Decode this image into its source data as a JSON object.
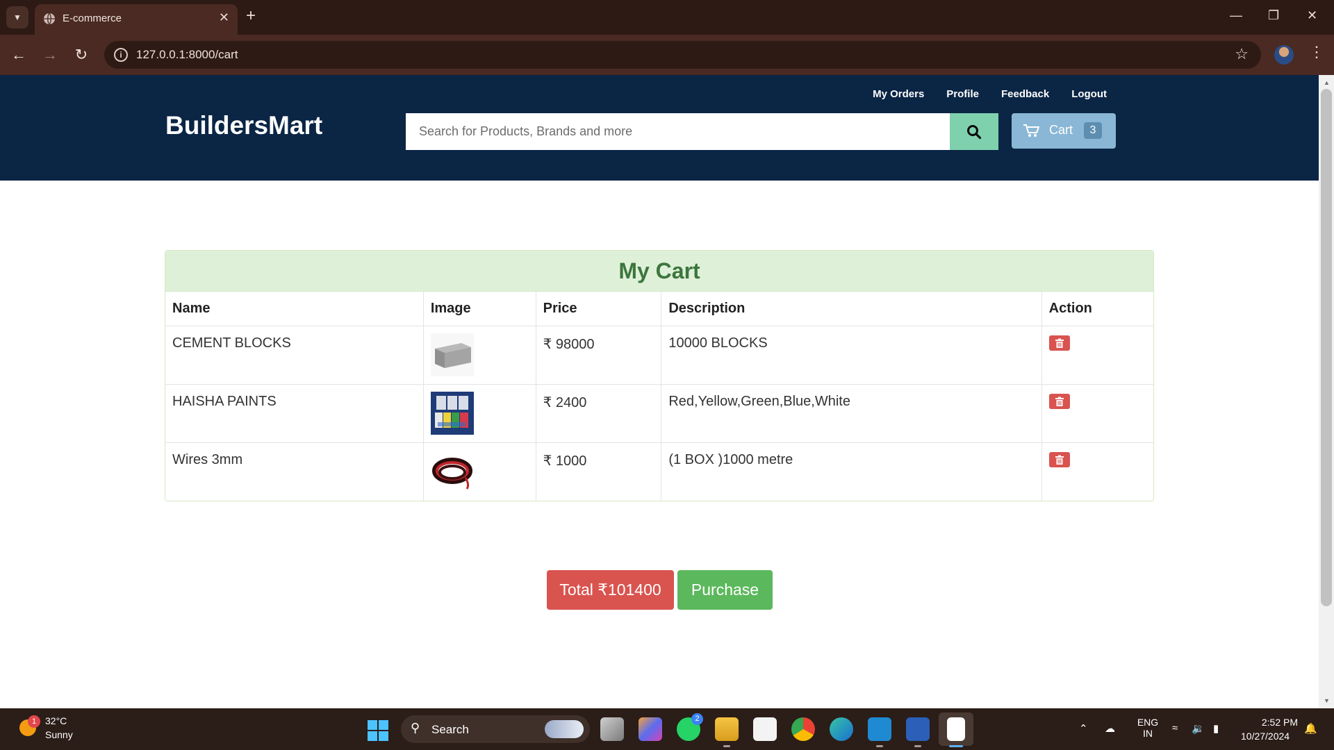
{
  "browser": {
    "tab_title": "E-commerce",
    "url": "127.0.0.1:8000/cart"
  },
  "header": {
    "brand": "BuildersMart",
    "links": [
      "My Orders",
      "Profile",
      "Feedback",
      "Logout"
    ],
    "search_placeholder": "Search for Products, Brands and more",
    "cart_label": "Cart",
    "cart_count": "3"
  },
  "cart": {
    "heading": "My Cart",
    "columns": [
      "Name",
      "Image",
      "Price",
      "Description",
      "Action"
    ],
    "rows": [
      {
        "name": "CEMENT BLOCKS",
        "image_icon": "cement-block-image",
        "price": "₹ 98000",
        "description": "10000 BLOCKS"
      },
      {
        "name": "HAISHA PAINTS",
        "image_icon": "paint-cans-image",
        "price": "₹ 2400",
        "description": "Red,Yellow,Green,Blue,White"
      },
      {
        "name": "Wires 3mm",
        "image_icon": "wire-coil-image",
        "price": "₹ 1000",
        "description": "(1 BOX )1000 metre"
      }
    ],
    "total_label": "Total ₹101400",
    "purchase_label": "Purchase"
  },
  "taskbar": {
    "weather_temp": "32°C",
    "weather_condition": "Sunny",
    "weather_badge": "1",
    "search_label": "Search",
    "whatsapp_badge": "2",
    "language": "ENG",
    "region": "IN",
    "time": "2:52 PM",
    "date": "10/27/2024"
  },
  "colors": {
    "header_bg": "#0b2545",
    "search_button": "#7fd1ae",
    "cart_button": "#8ab7d6",
    "cart_heading_bg": "#dff0d8",
    "cart_heading_text": "#3c763d",
    "danger": "#d9534f",
    "success": "#5cb85c"
  }
}
